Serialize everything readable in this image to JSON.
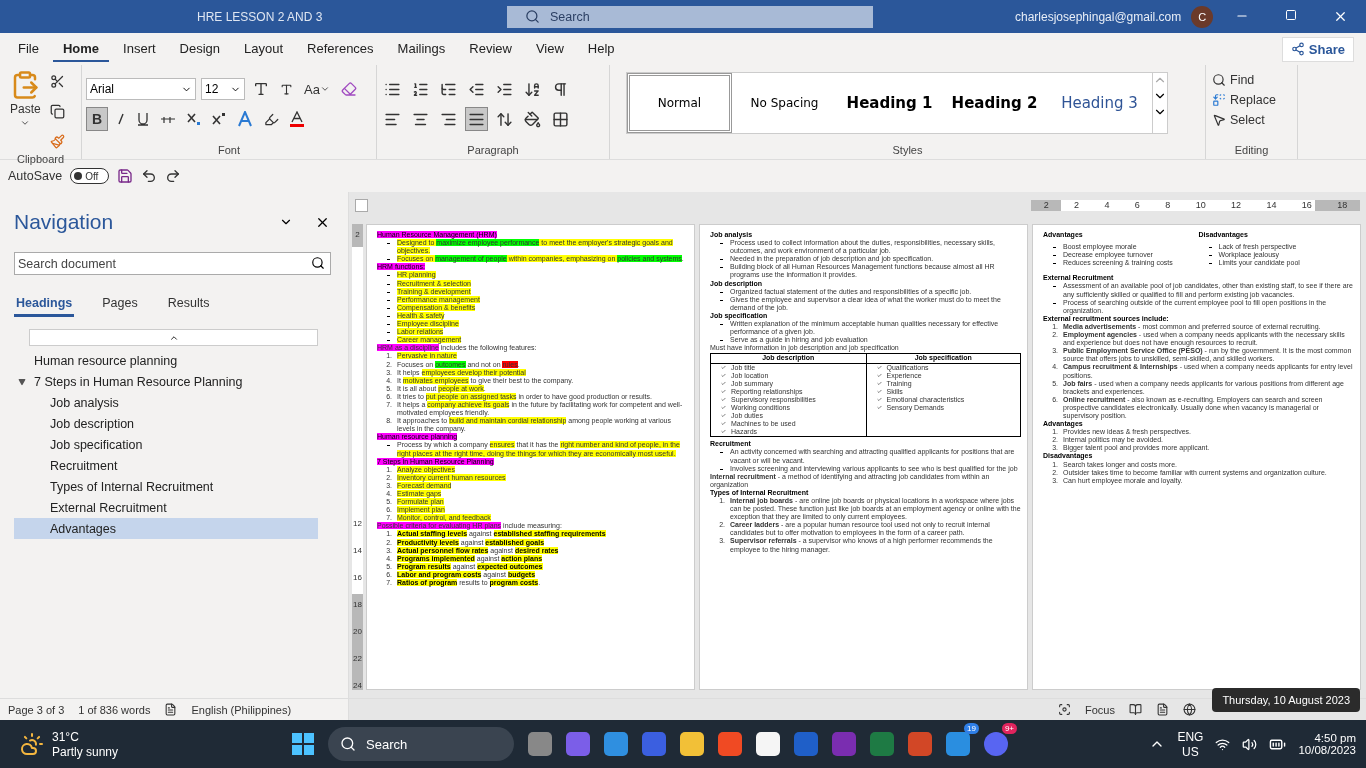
{
  "window": {
    "title": "HRE LESSON 2 AND 3",
    "search": "Search",
    "account": "charlesjosephingal@gmail.com",
    "avatar": "C"
  },
  "menu": [
    {
      "label": "File",
      "selected": false
    },
    {
      "label": "Home",
      "selected": true
    },
    {
      "label": "Insert",
      "selected": false
    },
    {
      "label": "Design",
      "selected": false
    },
    {
      "label": "Layout",
      "selected": false
    },
    {
      "label": "References",
      "selected": false
    },
    {
      "label": "Mailings",
      "selected": false
    },
    {
      "label": "Review",
      "selected": false
    },
    {
      "label": "View",
      "selected": false
    },
    {
      "label": "Help",
      "selected": false
    }
  ],
  "share": "Share",
  "ribbon": {
    "paste": "Paste",
    "font": "Arial",
    "size": "12",
    "case": "Aa",
    "bold_label": "B",
    "bold": true,
    "justify": true,
    "groups": [
      "Clipboard",
      "Font",
      "Paragraph",
      "Styles",
      "Editing"
    ],
    "styles": [
      {
        "label": "Normal",
        "kind": "normal",
        "selected": true
      },
      {
        "label": "No Spacing",
        "kind": "normal",
        "selected": false
      },
      {
        "label": "Heading 1",
        "kind": "h1",
        "selected": false
      },
      {
        "label": "Heading 2",
        "kind": "h2",
        "selected": false
      },
      {
        "label": "Heading 3",
        "kind": "h3",
        "selected": false
      }
    ],
    "editing": [
      "Find",
      "Replace",
      "Select"
    ]
  },
  "quick_access": {
    "autosave": "AutoSave",
    "toggle": "Off",
    "on": false
  },
  "navigation": {
    "title": "Navigation",
    "placeholder": "Search document",
    "tabs": [
      {
        "label": "Headings",
        "selected": true
      },
      {
        "label": "Pages",
        "selected": false
      },
      {
        "label": "Results",
        "selected": false
      }
    ],
    "tree": [
      {
        "label": "Human resource planning",
        "selected": false
      },
      {
        "label": "7 Steps in Human Resource Planning",
        "selected": false,
        "expanded": true,
        "children": [
          {
            "label": "Job analysis",
            "selected": false
          },
          {
            "label": "Job description",
            "selected": false
          },
          {
            "label": "Job specification",
            "selected": false
          },
          {
            "label": "Recruitment",
            "selected": false
          },
          {
            "label": "Types of Internal Recruitment",
            "selected": false
          },
          {
            "label": "External Recruitment",
            "selected": false
          },
          {
            "label": "Advantages",
            "selected": true
          }
        ]
      }
    ]
  },
  "ruler": {
    "horizontal": [
      "2",
      "2",
      "4",
      "6",
      "8",
      "10",
      "12",
      "14",
      "16",
      "18"
    ],
    "vertical": [
      "2",
      "12",
      "14",
      "16",
      "18",
      "20",
      "22",
      "24"
    ]
  },
  "pages": [
    {
      "blocks": [
        {
          "kind": "heading",
          "text": [
            {
              "text": "Human Resource Management (HRM)",
              "color": "#ff00ff"
            }
          ]
        },
        {
          "kind": "bullets",
          "items": [
            [
              {
                "text": "Designed to ",
                "color": "#ffff00"
              },
              {
                "text": "maximize employee performance",
                "color": "#00ff00"
              },
              {
                "text": " to meet the employer's strategic goals and objectives.",
                "color": "#ffff00"
              }
            ],
            [
              {
                "text": "Focuses on ",
                "color": "#ffff00"
              },
              {
                "text": "management of people",
                "color": "#00ff00"
              },
              {
                "text": " within companies, emphasizing on ",
                "color": "#ffff00"
              },
              {
                "text": "policies and systems",
                "color": "#00ff00"
              },
              {
                "text": "."
              }
            ]
          ]
        },
        {
          "kind": "heading",
          "text": [
            {
              "text": "HRM functions:",
              "color": "#ff00ff"
            }
          ]
        },
        {
          "kind": "bullets",
          "items": [
            [
              {
                "text": "HR planning",
                "color": "#ffff00"
              }
            ],
            [
              {
                "text": "Recruitment & selection",
                "color": "#ffff00"
              }
            ],
            [
              {
                "text": "Training & development",
                "color": "#ffff00"
              }
            ],
            [
              {
                "text": "Performance management",
                "color": "#ffff00"
              }
            ],
            [
              {
                "text": "Compensation & benefits",
                "color": "#ffff00"
              }
            ],
            [
              {
                "text": "Health & safety",
                "color": "#ffff00"
              }
            ],
            [
              {
                "text": "Employee discipline",
                "color": "#ffff00"
              }
            ],
            [
              {
                "text": "Labor relations",
                "color": "#ffff00"
              }
            ],
            [
              {
                "text": "Career management",
                "color": "#ffff00"
              }
            ]
          ]
        },
        {
          "kind": "paragraph",
          "text": [
            {
              "text": "HRM as a discipline",
              "color": "#ff00ff"
            },
            {
              "text": " includes the following features:"
            }
          ]
        },
        {
          "kind": "numbered",
          "items": [
            {
              "n": "1.",
              "text": [
                {
                  "text": "Pervasive in nature",
                  "color": "#ffff00"
                }
              ]
            },
            {
              "n": "2.",
              "text": [
                {
                  "text": "Focuses on "
                },
                {
                  "text": "outcomes",
                  "color": "#00ff00"
                },
                {
                  "text": " and not on "
                },
                {
                  "text": "rules",
                  "color": "#ff0000"
                },
                {
                  "text": "."
                }
              ]
            },
            {
              "n": "3.",
              "text": [
                {
                  "text": "It helps "
                },
                {
                  "text": "employees develop their potential",
                  "color": "#ffff00"
                }
              ]
            },
            {
              "n": "4.",
              "text": [
                {
                  "text": "It "
                },
                {
                  "text": "motivates employees",
                  "color": "#ffff00"
                },
                {
                  "text": " to give their best to the company."
                }
              ]
            },
            {
              "n": "5.",
              "text": [
                {
                  "text": "It is all about "
                },
                {
                  "text": "people at work",
                  "color": "#ffff00"
                },
                {
                  "text": "."
                }
              ]
            },
            {
              "n": "6.",
              "text": [
                {
                  "text": "It tries to "
                },
                {
                  "text": "put people on assigned tasks",
                  "color": "#ffff00"
                },
                {
                  "text": " in order to have good production or results."
                }
              ]
            },
            {
              "n": "7.",
              "text": [
                {
                  "text": "It helps a "
                },
                {
                  "text": "company achieve its goals",
                  "color": "#ffff00"
                },
                {
                  "text": " in the future by facilitating work for competent and well-motivated employees friendly."
                }
              ]
            },
            {
              "n": "8.",
              "text": [
                {
                  "text": "It approaches to "
                },
                {
                  "text": "build and maintain cordial relationship",
                  "color": "#ffff00"
                },
                {
                  "text": " among people working at various levels in the company."
                }
              ]
            }
          ]
        },
        {
          "kind": "heading",
          "text": [
            {
              "text": "Human resource planning",
              "color": "#ff00ff"
            }
          ]
        },
        {
          "kind": "bullets",
          "items": [
            [
              {
                "text": "Process by which a company "
              },
              {
                "text": "ensures",
                "color": "#ffff00"
              },
              {
                "text": " that it has the "
              },
              {
                "text": "right number and kind of people, in the right places at the right time, doing the things for which they are economically most useful.",
                "color": "#ffff00"
              }
            ]
          ]
        },
        {
          "kind": "heading",
          "text": [
            {
              "text": "7 Steps in Human Resource Planning",
              "color": "#ff00ff"
            }
          ]
        },
        {
          "kind": "numbered",
          "items": [
            {
              "n": "1.",
              "text": [
                {
                  "text": "Analyze objectives",
                  "color": "#ffff00"
                }
              ]
            },
            {
              "n": "2.",
              "text": [
                {
                  "text": "Inventory current human resources",
                  "color": "#ffff00"
                }
              ]
            },
            {
              "n": "3.",
              "text": [
                {
                  "text": "Forecast demand",
                  "color": "#ffff00"
                }
              ]
            },
            {
              "n": "4.",
              "text": [
                {
                  "text": "Estimate gaps",
                  "color": "#ffff00"
                }
              ]
            },
            {
              "n": "5.",
              "text": [
                {
                  "text": "Formulate plan",
                  "color": "#ffff00"
                }
              ]
            },
            {
              "n": "6.",
              "text": [
                {
                  "text": "Implement plan",
                  "color": "#ffff00"
                }
              ]
            },
            {
              "n": "7.",
              "text": [
                {
                  "text": "Monitor, control, and feedback",
                  "color": "#ffff00"
                }
              ]
            }
          ]
        },
        {
          "kind": "paragraph",
          "text": [
            {
              "text": "Possible criteria for evaluating HR plans",
              "color": "#ff00ff"
            },
            {
              "text": " include measuring:"
            }
          ]
        },
        {
          "kind": "numbered",
          "items": [
            {
              "n": "1.",
              "text": [
                {
                  "text": "Actual staffing levels",
                  "color": "#ffff00",
                  "bold": true
                },
                {
                  "text": " against "
                },
                {
                  "text": "established staffing requirements",
                  "color": "#ffff00",
                  "bold": true
                }
              ]
            },
            {
              "n": "2.",
              "text": [
                {
                  "text": "Productivity levels",
                  "color": "#ffff00",
                  "bold": true
                },
                {
                  "text": " against "
                },
                {
                  "text": "established goals",
                  "color": "#ffff00",
                  "bold": true
                }
              ]
            },
            {
              "n": "3.",
              "text": [
                {
                  "text": "Actual personnel flow rates",
                  "color": "#ffff00",
                  "bold": true
                },
                {
                  "text": " against "
                },
                {
                  "text": "desired rates",
                  "color": "#ffff00",
                  "bold": true
                }
              ]
            },
            {
              "n": "4.",
              "text": [
                {
                  "text": "Programs implemented",
                  "color": "#ffff00",
                  "bold": true
                },
                {
                  "text": " against "
                },
                {
                  "text": "action plans",
                  "color": "#ffff00",
                  "bold": true
                }
              ]
            },
            {
              "n": "5.",
              "text": [
                {
                  "text": "Program results",
                  "color": "#ffff00",
                  "bold": true
                },
                {
                  "text": " against "
                },
                {
                  "text": "expected outcomes",
                  "color": "#ffff00",
                  "bold": true
                }
              ]
            },
            {
              "n": "6.",
              "text": [
                {
                  "text": "Labor and program costs",
                  "color": "#ffff00",
                  "bold": true
                },
                {
                  "text": " against "
                },
                {
                  "text": "budgets",
                  "color": "#ffff00",
                  "bold": true
                }
              ]
            },
            {
              "n": "7.",
              "text": [
                {
                  "text": "Ratios of program",
                  "color": "#ffff00",
                  "bold": true
                },
                {
                  "text": " results to "
                },
                {
                  "text": "program costs",
                  "color": "#ffff00",
                  "bold": true
                },
                {
                  "text": "."
                }
              ]
            }
          ]
        }
      ]
    },
    {
      "blocks": [
        {
          "kind": "heading",
          "text": "Job analysis"
        },
        {
          "kind": "bullets",
          "items": [
            "Process used to collect information about the duties, responsibilities, necessary skills, outcomes, and work environment of a particular job.",
            "Needed in the preparation of job description and job specification.",
            "Building block of all Human Resources Management functions because almost all HR programs use the information it provides."
          ]
        },
        {
          "kind": "heading",
          "text": "Job description"
        },
        {
          "kind": "bullets",
          "items": [
            "Organized factual statement of the duties and responsibilities of a specific job.",
            "Gives the employee and supervisor a clear idea of what the worker must do to meet the demand of the job."
          ]
        },
        {
          "kind": "heading",
          "text": "Job specification"
        },
        {
          "kind": "bullets",
          "items": [
            "Written explanation of the minimum acceptable human qualities necessary for effective performance of a given job.",
            "Serve as a guide in hiring and job evaluation"
          ]
        },
        {
          "kind": "paragraph",
          "text": "Must have information in job description and job specification"
        },
        {
          "kind": "table",
          "columns": [
            "Job description",
            "Job specification"
          ],
          "cells": [
            [
              "Job title",
              "Job location",
              "Job summary",
              "Reporting relationships",
              "Supervisory responsibilities",
              "Working conditions",
              "Job duties",
              "Machines to be used",
              "Hazards"
            ],
            [
              "Qualifications",
              "Experience",
              "Training",
              "Skills",
              "Emotional characteristics",
              "Sensory Demands"
            ]
          ]
        },
        {
          "kind": "heading",
          "text": "Recruitment"
        },
        {
          "kind": "bullets",
          "items": [
            "An activity concerned with searching and attracting qualified applicants for positions that are vacant or will be vacant.",
            "Involves screening and interviewing various applicants to see who is best qualified for the job"
          ]
        },
        {
          "kind": "paragraph",
          "text": "**Internal recruitment** - a method of identifying and attracting job candidates from within an organization"
        },
        {
          "kind": "heading",
          "text": "Types of Internal Recruitment"
        },
        {
          "kind": "numbered",
          "items": [
            {
              "n": "1.",
              "text": "**Internal job boards** - are online job boards or physical locations in a workspace where jobs can be posted. These function just like job boards at an employment agency or online with the exception that they are limited to only current employees."
            },
            {
              "n": "2.",
              "text": "**Career ladders** - are a popular human resource tool used not only to recruit internal candidates but to offer motivation to employees in the form of a career path."
            },
            {
              "n": "3.",
              "text": "**Supervisor referrals** - a supervisor who knows of a high performer recommends the employee to the hiring manager."
            }
          ]
        }
      ]
    },
    {
      "blocks": [
        {
          "kind": "columns",
          "columns": [
            {
              "title": "Advantages",
              "items": [
                "Boost employee morale",
                "Decrease employee turnover",
                "Reduces screening & training costs"
              ]
            },
            {
              "title": "Disadvantages",
              "items": [
                "Lack of fresh perspective",
                "Workplace jealousy",
                "Limits your candidate pool"
              ]
            }
          ]
        },
        {
          "kind": "heading",
          "text": "External Recruitment"
        },
        {
          "kind": "bullets",
          "items": [
            "Assessment of an available pool of job candidates, other than existing staff, to see if there are any sufficiently skilled or qualified to fill and perform existing job vacancies.",
            "Process of searching outside of the current employee pool to fill open positions in the organization."
          ]
        },
        {
          "kind": "heading",
          "text": "External recruitment sources include:"
        },
        {
          "kind": "numbered",
          "items": [
            {
              "n": "1.",
              "text": "**Media advertisements** - most common and preferred source of external recruiting."
            },
            {
              "n": "2.",
              "text": "**Employment agencies** - used when a company needs applicants with the necessary skills and experience but does not have enough resources to recruit."
            },
            {
              "n": "3.",
              "text": "**Public Employment Service Office (PESO)** - run by the government. It is the most common source that offers jobs to unskilled, semi-skilled, and skilled workers."
            },
            {
              "n": "4.",
              "text": "**Campus recruitment & Internships** - used when a company needs applicants for entry level positions."
            },
            {
              "n": "5.",
              "text": "**Job fairs** - used when a company needs applicants for various positions from different age brackets and experiences."
            },
            {
              "n": "6.",
              "text": "**Online recruitment** - also known as e-recruiting. Employers can search and screen prospective candidates electronically. Usually done when vacancy is managerial or supervisory position."
            }
          ]
        },
        {
          "kind": "heading",
          "text": "Advantages"
        },
        {
          "kind": "numbered",
          "items": [
            {
              "n": "1.",
              "text": "Provides new ideas & fresh perspectives."
            },
            {
              "n": "2.",
              "text": "Internal politics may be avoided."
            },
            {
              "n": "3.",
              "text": "Bigger talent pool and provides more applicant."
            }
          ]
        },
        {
          "kind": "heading",
          "text": "Disadvantages"
        },
        {
          "kind": "numbered",
          "items": [
            {
              "n": "1.",
              "text": "Search takes longer and costs more."
            },
            {
              "n": "2.",
              "text": "Outsider takes time to become familiar with current systems and organization culture."
            },
            {
              "n": "3.",
              "text": "Can hurt employee morale and loyalty."
            }
          ]
        }
      ]
    }
  ],
  "status_bar": {
    "page": "Page 3 of 3",
    "words": "1 of 836 words",
    "language": "English (Philippines)",
    "focus": "Focus",
    "tooltip": "Thursday, 10 August 2023"
  },
  "taskbar": {
    "temperature": "31°C",
    "weather": "Partly sunny",
    "search": "Search",
    "mail_badge": "19",
    "chat_badge": "9+",
    "lang": "ENG",
    "region": "US",
    "time": "4:50 pm",
    "date": "10/08/2023"
  }
}
